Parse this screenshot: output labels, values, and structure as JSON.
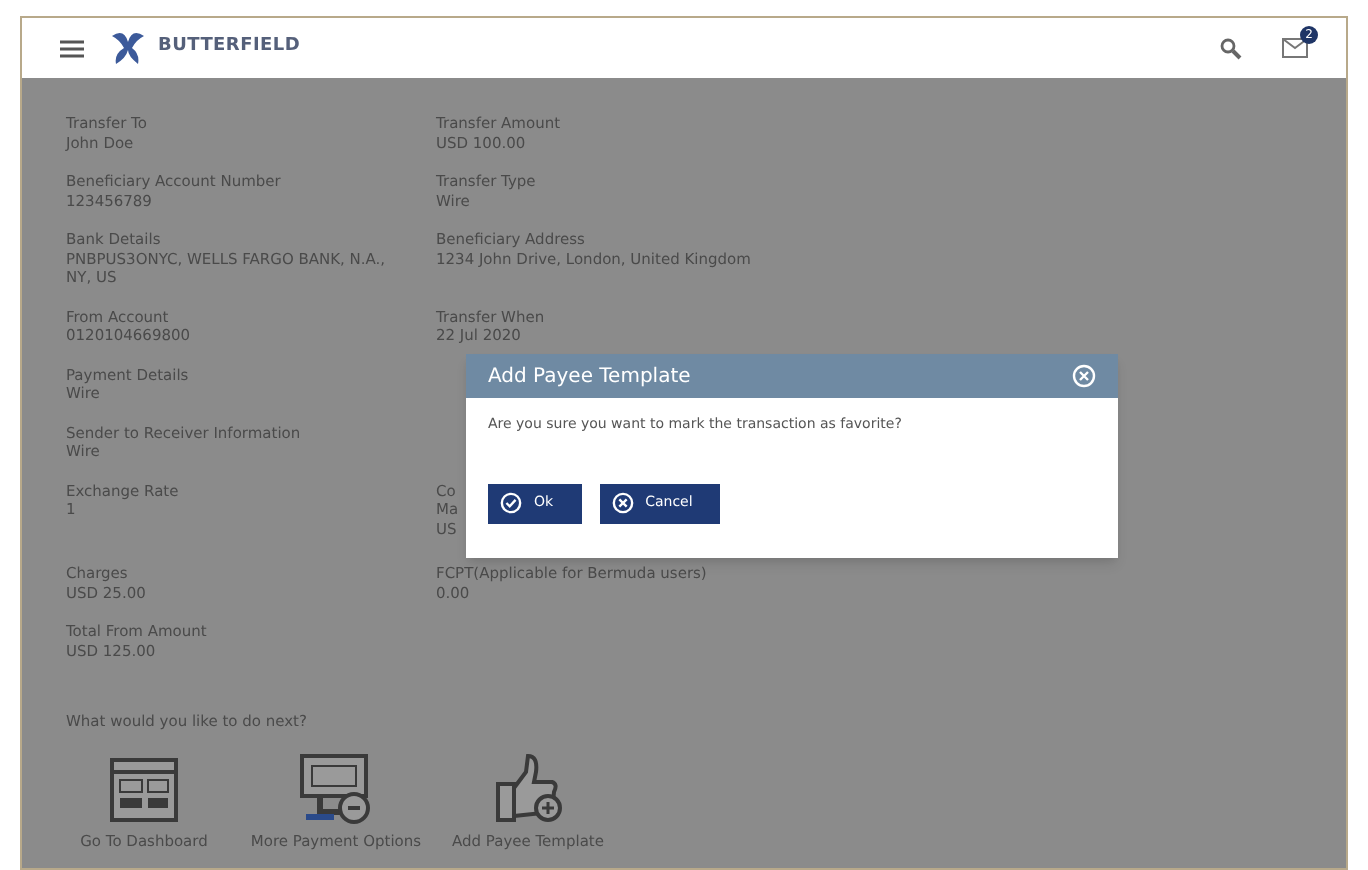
{
  "header": {
    "brand": "BUTTERFIELD",
    "notification_count": "2"
  },
  "details": [
    {
      "cells": [
        {
          "kind": "field",
          "label": "Transfer To",
          "value": "John Doe"
        },
        {
          "kind": "field",
          "label": "Transfer Amount",
          "value": "USD 100.00"
        }
      ]
    },
    {
      "cells": [
        {
          "kind": "field",
          "label": "Beneficiary Account Number",
          "value": "123456789"
        },
        {
          "kind": "field",
          "label": "Transfer Type",
          "value": "Wire"
        }
      ]
    },
    {
      "cells": [
        {
          "kind": "field",
          "label": "Bank Details",
          "value": "PNBPUS3ONYC, WELLS FARGO BANK, N.A., NY, US"
        },
        {
          "kind": "field",
          "label": "Beneficiary Address",
          "value": "1234 John Drive, London, United Kingdom"
        }
      ]
    },
    {
      "cells": [
        {
          "kind": "field",
          "label": "From Account",
          "value": "0120104669800"
        },
        {
          "kind": "field",
          "label": "Transfer When",
          "value": "22 Jul 2020"
        }
      ]
    },
    {
      "cells": [
        {
          "kind": "field",
          "label": "Payment Details",
          "value": "Wire"
        }
      ]
    },
    {
      "cells": [
        {
          "kind": "field",
          "label": "Sender to Receiver Information",
          "value": "Wire"
        }
      ]
    },
    {
      "cells": [
        {
          "kind": "field",
          "label": "Exchange Rate",
          "value": "1"
        },
        {
          "kind": "partial",
          "lines": [
            "Co",
            "Ma",
            "US"
          ]
        }
      ]
    },
    {
      "cells": [
        {
          "kind": "field",
          "label": "Charges",
          "value": "USD 25.00"
        },
        {
          "kind": "field",
          "label": "FCPT(Applicable for Bermuda users)",
          "value": "0.00"
        }
      ]
    },
    {
      "cells": [
        {
          "kind": "field",
          "label": "Total From Amount",
          "value": "USD 125.00"
        }
      ]
    }
  ],
  "next_prompt": "What would you like to do next?",
  "actions": [
    {
      "kind": "dashboard",
      "label": "Go To Dashboard"
    },
    {
      "kind": "payment",
      "label": "More Payment Options"
    },
    {
      "kind": "template",
      "label": "Add Payee Template"
    }
  ],
  "dialog": {
    "title": "Add Payee Template",
    "message": "Are you sure you want to mark the transaction as favorite?",
    "buttons": [
      {
        "kind": "ok",
        "label": "Ok"
      },
      {
        "kind": "cancel",
        "label": "Cancel"
      }
    ]
  }
}
